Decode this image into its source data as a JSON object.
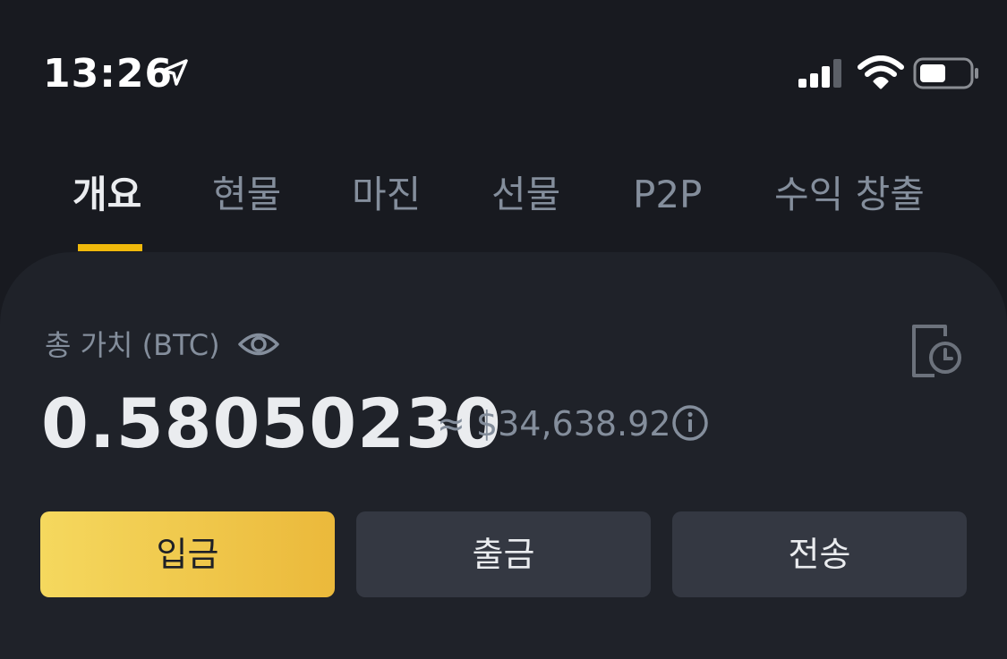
{
  "status_bar": {
    "time": "13:26",
    "icons": [
      "location-arrow-icon",
      "cellular-signal-icon",
      "wifi-icon",
      "battery-icon"
    ]
  },
  "tabs": [
    {
      "label": "개요",
      "active": true
    },
    {
      "label": "현물",
      "active": false
    },
    {
      "label": "마진",
      "active": false
    },
    {
      "label": "선물",
      "active": false
    },
    {
      "label": "P2P",
      "active": false
    },
    {
      "label": "수익 창출",
      "active": false
    }
  ],
  "balance": {
    "label": "총 가치 (BTC)",
    "value": "0.58050230",
    "fiat": "≈ $34,638.92",
    "icons": [
      "eye-icon",
      "info-icon",
      "history-icon"
    ]
  },
  "actions": {
    "deposit": "입금",
    "withdraw": "출금",
    "transfer": "전송"
  },
  "colors": {
    "background": "#181a20",
    "card": "#1f2229",
    "accent": "#f0b90b",
    "button_secondary": "#343842",
    "text_primary": "#eaecef",
    "text_secondary": "#848e9c"
  }
}
